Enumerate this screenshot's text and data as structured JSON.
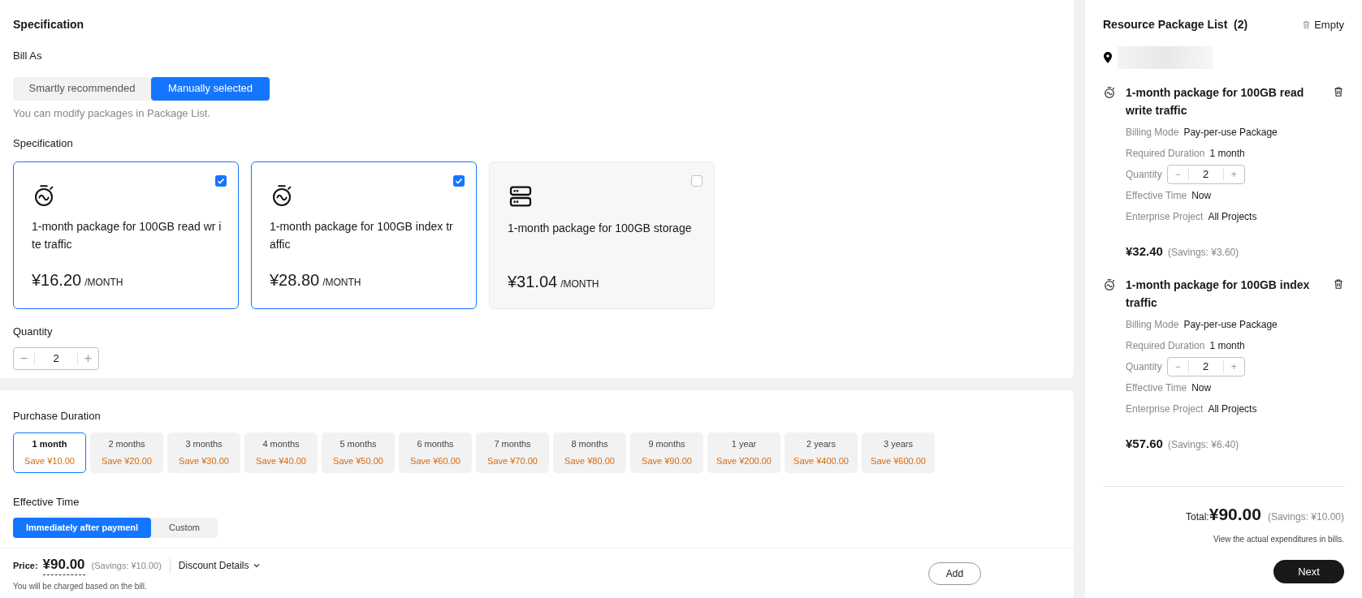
{
  "specification": {
    "title": "Specification",
    "bill_as": {
      "label": "Bill As",
      "options": [
        {
          "label": "Smartly recommended",
          "selected": false
        },
        {
          "label": "Manually selected",
          "selected": true
        }
      ],
      "hint": "You can modify packages in Package List."
    },
    "spec_label": "Specification",
    "packages": [
      {
        "kind": "clock",
        "name": "1-month package for 100GB read wr ite traffic",
        "price": "¥16.20",
        "unit": "/MONTH",
        "checked": true
      },
      {
        "kind": "clock",
        "name": "1-month package for 100GB index tr affic",
        "price": "¥28.80",
        "unit": "/MONTH",
        "checked": true
      },
      {
        "kind": "storage",
        "name": "1-month package for 100GB storage",
        "price": "¥31.04",
        "unit": "/MONTH",
        "checked": false
      }
    ],
    "quantity": {
      "label": "Quantity",
      "minus": "−",
      "value": "2",
      "plus": "+"
    }
  },
  "purchase": {
    "duration_label": "Purchase Duration",
    "durations": [
      {
        "label": "1 month",
        "save": "Save ¥10.00",
        "selected": true
      },
      {
        "label": "2 months",
        "save": "Save ¥20.00",
        "selected": false
      },
      {
        "label": "3 months",
        "save": "Save ¥30.00",
        "selected": false
      },
      {
        "label": "4 months",
        "save": "Save ¥40.00",
        "selected": false
      },
      {
        "label": "5 months",
        "save": "Save ¥50.00",
        "selected": false
      },
      {
        "label": "6 months",
        "save": "Save ¥60.00",
        "selected": false
      },
      {
        "label": "7 months",
        "save": "Save ¥70.00",
        "selected": false
      },
      {
        "label": "8 months",
        "save": "Save ¥80.00",
        "selected": false
      },
      {
        "label": "9 months",
        "save": "Save ¥90.00",
        "selected": false
      },
      {
        "label": "1 year",
        "save": "Save ¥200.00",
        "selected": false
      },
      {
        "label": "2 years",
        "save": "Save ¥400.00",
        "selected": false
      },
      {
        "label": "3 years",
        "save": "Save ¥600.00",
        "selected": false
      }
    ],
    "effective_label": "Effective Time",
    "effective_options": [
      {
        "label": "Immediately after paymenl",
        "selected": true
      },
      {
        "label": "Custom",
        "selected": false
      }
    ]
  },
  "price_bar": {
    "label": "Price:",
    "price": "¥90.00",
    "savings": "(Savings: ¥10.00)",
    "discount": "Discount Details",
    "note": "You will be charged based on the bill.",
    "add": "Add"
  },
  "package_list": {
    "title": "Resource Package List",
    "count": "(2)",
    "empty": "Empty",
    "items": [
      {
        "name": "1-month package for 100GB read write traffic",
        "fields": [
          {
            "kind": "text",
            "label": "Billing Mode",
            "value": "Pay-per-use Package"
          },
          {
            "kind": "text",
            "label": "Required Duration",
            "value": "1 month"
          },
          {
            "kind": "stepper",
            "label": "Quantity",
            "minus": "−",
            "value": "2",
            "plus": "+"
          },
          {
            "kind": "text",
            "label": "Effective Time",
            "value": "Now"
          },
          {
            "kind": "text",
            "label": "Enterprise Project",
            "value": "All Projects"
          }
        ],
        "price": "¥32.40",
        "savings": "(Savings: ¥3.60)"
      },
      {
        "name": "1-month package for 100GB index traffic",
        "fields": [
          {
            "kind": "text",
            "label": "Billing Mode",
            "value": "Pay-per-use Package"
          },
          {
            "kind": "text",
            "label": "Required Duration",
            "value": "1 month"
          },
          {
            "kind": "stepper",
            "label": "Quantity",
            "minus": "−",
            "value": "2",
            "plus": "+"
          },
          {
            "kind": "text",
            "label": "Effective Time",
            "value": "Now"
          },
          {
            "kind": "text",
            "label": "Enterprise Project",
            "value": "All Projects"
          }
        ],
        "price": "¥57.60",
        "savings": "(Savings: ¥6.40)"
      }
    ],
    "total_label": "Total:",
    "total": "¥90.00",
    "total_savings": "(Savings: ¥10.00)",
    "note": "View the actual expenditures in bills.",
    "next": "Next"
  }
}
